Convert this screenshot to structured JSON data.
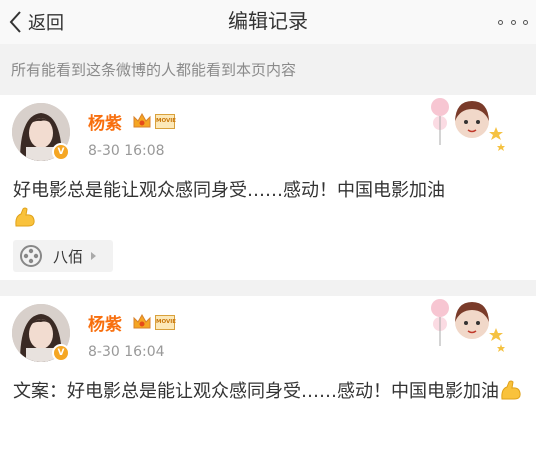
{
  "navbar": {
    "back_label": "返回",
    "title": "编辑记录"
  },
  "notice": "所有能看到这条微博的人都能看到本页内容",
  "records": [
    {
      "author": "杨紫",
      "time": "8-30 16:08",
      "text": "好电影总是能让观众感同身受……感动！中国电影加油",
      "tag": "八佰"
    },
    {
      "author": "杨紫",
      "time": "8-30 16:04",
      "text": "文案：好电影总是能让观众感同身受……感动！中国电影加油"
    }
  ],
  "badge": {
    "vip_text": "MOVIE"
  },
  "colors": {
    "name": "#f86f0e",
    "accent_badge": "#f5a623"
  },
  "icons": [
    "back-chevron-icon",
    "more-icon",
    "crown-icon",
    "movie-badge-icon",
    "verified-badge-icon",
    "flexed-biceps-emoji",
    "film-reel-icon"
  ]
}
